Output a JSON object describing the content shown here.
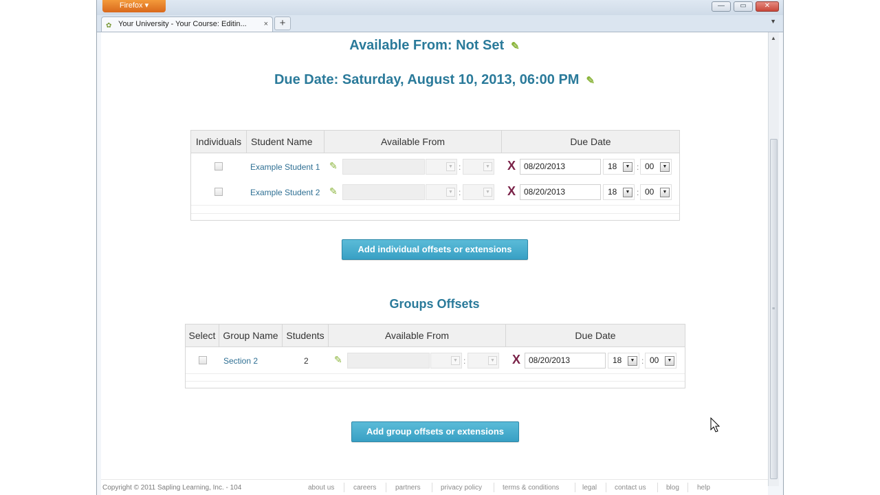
{
  "browser": {
    "menu_button": "Firefox ▾",
    "tab_title": "Your University - Your Course: Editin...",
    "tab_close": "×",
    "new_tab": "+",
    "tab_list": "▼",
    "minimize": "—",
    "restore": "▭",
    "close": "✕"
  },
  "assignment": {
    "available_from": "Available From: Not Set",
    "due_date": "Due Date: Saturday, August 10, 2013, 06:00 PM"
  },
  "individuals": {
    "columns": [
      "Individuals",
      "Student Name",
      "Available From",
      "Due Date"
    ],
    "rows": [
      {
        "name": "Example Student 1",
        "due_date": "08/20/2013",
        "hour": "18",
        "minute": "00"
      },
      {
        "name": "Example Student 2",
        "due_date": "08/20/2013",
        "hour": "18",
        "minute": "00"
      }
    ],
    "add_button": "Add individual offsets or extensions"
  },
  "groups": {
    "title": "Groups Offsets",
    "columns": [
      "Select",
      "Group Name",
      "Students",
      "Available From",
      "Due Date"
    ],
    "rows": [
      {
        "name": "Section 2",
        "students": "2",
        "due_date": "08/20/2013",
        "hour": "18",
        "minute": "00"
      }
    ],
    "add_button": "Add group offsets or extensions"
  },
  "footer": {
    "copyright": "Copyright © 2011 Sapling Learning, Inc. - 104",
    "links": [
      "about us",
      "careers",
      "partners",
      "privacy policy",
      "terms & conditions",
      "legal",
      "contact us",
      "blog",
      "help"
    ]
  },
  "icons": {
    "pencil": "✎",
    "remove": "X",
    "dropdown": "▼"
  },
  "colors": {
    "accent": "#2a7a9a",
    "button": "#3aa6c9",
    "remove_x": "#7a2248",
    "pencil": "#8ab43a",
    "browser_orange": "#e5792a"
  }
}
